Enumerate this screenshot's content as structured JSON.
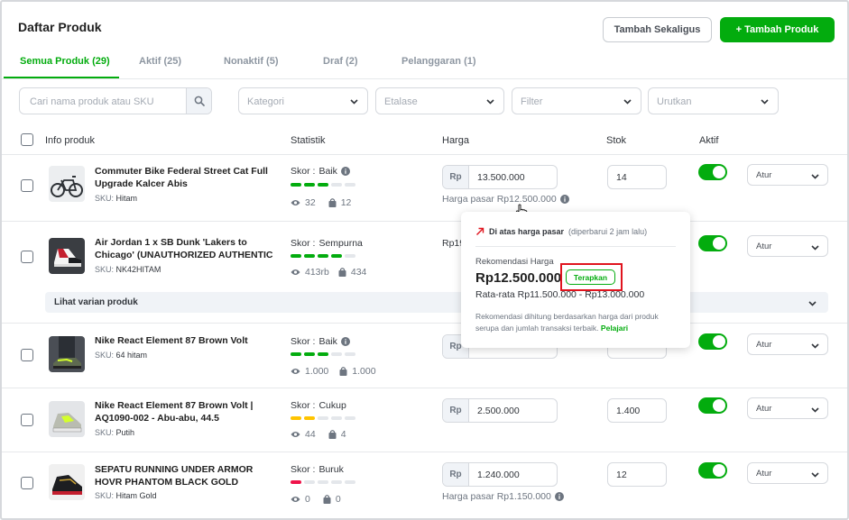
{
  "page": {
    "title": "Daftar Produk"
  },
  "header": {
    "bulk_button": "Tambah Sekaligus",
    "add_button": "+ Tambah Produk"
  },
  "tabs": [
    {
      "label": "Semua Produk (29)",
      "active": true
    },
    {
      "label": "Aktif (25)"
    },
    {
      "label": "Nonaktif (5)"
    },
    {
      "label": "Draf (2)"
    },
    {
      "label": "Pelanggaran (1)"
    }
  ],
  "filters": {
    "search_placeholder": "Cari nama produk atau SKU",
    "kategori": "Kategori",
    "etalase": "Etalase",
    "filter": "Filter",
    "urutkan": "Urutkan"
  },
  "table": {
    "headers": {
      "info": "Info produk",
      "statistik": "Statistik",
      "harga": "Harga",
      "stok": "Stok",
      "aktif": "Aktif"
    },
    "currency": "Rp",
    "sku_label": "SKU:",
    "score_label": "Skor : ",
    "action_label": "Atur",
    "products": [
      {
        "name": "Commuter Bike Federal Street Cat Full Upgrade Kalcer Abis",
        "sku": "Hitam",
        "score": "Baik",
        "score_level": 3,
        "score_color": "#03ac0e",
        "views": "32",
        "sold": "12",
        "price": "13.500.000",
        "market_price": "Harga pasar Rp12.500.000",
        "stock": "14",
        "active": true
      },
      {
        "name": "Air Jordan 1 x SB Dunk 'Lakers to Chicago' (UNAUTHORIZED AUTHENTIC",
        "sku": "NK42HITAM",
        "score": "Sempurna",
        "score_level": 4,
        "score_color": "#03ac0e",
        "views": "413rb",
        "sold": "434",
        "price_partial": "Rp19",
        "active": true
      },
      {
        "name": "Nike React Element 87 Brown Volt",
        "sku": "64 hitam",
        "score": "Baik",
        "score_level": 3,
        "score_color": "#03ac0e",
        "views": "1.000",
        "sold": "1.000",
        "active": true
      },
      {
        "name": "Nike React Element 87 Brown Volt | AQ1090-002 - Abu-abu, 44.5",
        "sku": "Putih",
        "score": "Cukup",
        "score_level": 2,
        "score_color": "#ffc400",
        "views": "44",
        "sold": "4",
        "price": "2.500.000",
        "stock": "1.400",
        "active": true
      },
      {
        "name": "SEPATU RUNNING UNDER ARMOR HOVR PHANTOM BLACK GOLD",
        "sku": "Hitam Gold",
        "score": "Buruk",
        "score_level": 1,
        "score_color": "#ef144a",
        "views": "0",
        "sold": "0",
        "price": "1.240.000",
        "market_price": "Harga pasar Rp1.150.000",
        "stock": "12",
        "active": true
      }
    ],
    "variant_toggle": "Lihat varian produk"
  },
  "popup": {
    "title": "Di atas harga pasar",
    "updated": "(diperbarui 2 jam lalu)",
    "rekomendasi_label": "Rekomendasi Harga",
    "recommended_price": "Rp12.500.000",
    "apply_button": "Terapkan",
    "average_range": "Rata-rata Rp11.500.000 - Rp13.000.000",
    "note": "Rekomendasi dihitung berdasarkan harga dari produk serupa dan jumlah transaksi terbaik.",
    "learn_link": "Pelajari"
  }
}
